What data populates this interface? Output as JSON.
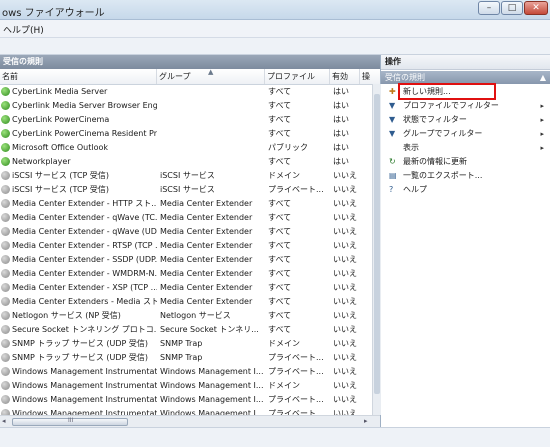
{
  "window": {
    "title": "ows ファイアウォール",
    "min": "–",
    "max": "□",
    "close": "✕"
  },
  "menu": {
    "help": "ヘルプ(H)"
  },
  "left_pane": {
    "header": "受信の規則",
    "columns": {
      "name": "名前",
      "group": "グループ",
      "profile": "プロファイル",
      "enabled": "有効",
      "action": "操"
    },
    "rows": [
      {
        "name": "CyberLink Media Server",
        "group": "",
        "profile": "すべて",
        "enabled": "はい",
        "icon": "on"
      },
      {
        "name": "Cyberlink Media Server Browser Eng...",
        "group": "",
        "profile": "すべて",
        "enabled": "はい",
        "icon": "on"
      },
      {
        "name": "CyberLink PowerCinema",
        "group": "",
        "profile": "すべて",
        "enabled": "はい",
        "icon": "on"
      },
      {
        "name": "CyberLink PowerCinema Resident Pr...",
        "group": "",
        "profile": "すべて",
        "enabled": "はい",
        "icon": "on"
      },
      {
        "name": "Microsoft Office Outlook",
        "group": "",
        "profile": "パブリック",
        "enabled": "はい",
        "icon": "on"
      },
      {
        "name": "Networkplayer",
        "group": "",
        "profile": "すべて",
        "enabled": "はい",
        "icon": "on"
      },
      {
        "name": "iSCSI サービス (TCP 受信)",
        "group": "iSCSI サービス",
        "profile": "ドメイン",
        "enabled": "いいえ",
        "icon": "off"
      },
      {
        "name": "iSCSI サービス (TCP 受信)",
        "group": "iSCSI サービス",
        "profile": "プライベート...",
        "enabled": "いいえ",
        "icon": "off"
      },
      {
        "name": "Media Center Extender - HTTP スト...",
        "group": "Media Center Extender",
        "profile": "すべて",
        "enabled": "いいえ",
        "icon": "off"
      },
      {
        "name": "Media Center Extender - qWave (TC...",
        "group": "Media Center Extender",
        "profile": "すべて",
        "enabled": "いいえ",
        "icon": "off"
      },
      {
        "name": "Media Center Extender - qWave (UD...",
        "group": "Media Center Extender",
        "profile": "すべて",
        "enabled": "いいえ",
        "icon": "off"
      },
      {
        "name": "Media Center Extender - RTSP (TCP ...",
        "group": "Media Center Extender",
        "profile": "すべて",
        "enabled": "いいえ",
        "icon": "off"
      },
      {
        "name": "Media Center Extender - SSDP (UDP...",
        "group": "Media Center Extender",
        "profile": "すべて",
        "enabled": "いいえ",
        "icon": "off"
      },
      {
        "name": "Media Center Extender - WMDRM-N...",
        "group": "Media Center Extender",
        "profile": "すべて",
        "enabled": "いいえ",
        "icon": "off"
      },
      {
        "name": "Media Center Extender - XSP (TCP ...",
        "group": "Media Center Extender",
        "profile": "すべて",
        "enabled": "いいえ",
        "icon": "off"
      },
      {
        "name": "Media Center Extenders - Media スト...",
        "group": "Media Center Extender",
        "profile": "すべて",
        "enabled": "いいえ",
        "icon": "off"
      },
      {
        "name": "Netlogon サービス (NP 受信)",
        "group": "Netlogon サービス",
        "profile": "すべて",
        "enabled": "いいえ",
        "icon": "off"
      },
      {
        "name": "Secure Socket トンネリング プロトコ...",
        "group": "Secure Socket トンネリ...",
        "profile": "すべて",
        "enabled": "いいえ",
        "icon": "off"
      },
      {
        "name": "SNMP トラップ サービス (UDP 受信)",
        "group": "SNMP Trap",
        "profile": "ドメイン",
        "enabled": "いいえ",
        "icon": "off"
      },
      {
        "name": "SNMP トラップ サービス (UDP 受信)",
        "group": "SNMP Trap",
        "profile": "プライベート...",
        "enabled": "いいえ",
        "icon": "off"
      },
      {
        "name": "Windows Management Instrumentat...",
        "group": "Windows Management I...",
        "profile": "プライベート...",
        "enabled": "いいえ",
        "icon": "off"
      },
      {
        "name": "Windows Management Instrumentat...",
        "group": "Windows Management I...",
        "profile": "ドメイン",
        "enabled": "いいえ",
        "icon": "off"
      },
      {
        "name": "Windows Management Instrumentat...",
        "group": "Windows Management I...",
        "profile": "プライベート...",
        "enabled": "いいえ",
        "icon": "off"
      },
      {
        "name": "Windows Management Instrumentat...",
        "group": "Windows Management I...",
        "profile": "プライベート...",
        "enabled": "いいえ",
        "icon": "off"
      }
    ],
    "hscroll_grip": "III"
  },
  "actions_pane": {
    "header": "操作",
    "section": "受信の規則",
    "items": [
      {
        "label": "新しい規則...",
        "icon": "new-rule-icon",
        "glyph": "✚",
        "submenu": ""
      },
      {
        "label": "プロファイルでフィルター",
        "icon": "filter-icon",
        "glyph": "▼",
        "submenu": "▸"
      },
      {
        "label": "状態でフィルター",
        "icon": "filter-icon",
        "glyph": "▼",
        "submenu": "▸"
      },
      {
        "label": "グループでフィルター",
        "icon": "filter-icon",
        "glyph": "▼",
        "submenu": "▸"
      },
      {
        "label": "表示",
        "icon": "",
        "glyph": "",
        "submenu": "▸"
      },
      {
        "label": "最新の情報に更新",
        "icon": "refresh-icon",
        "glyph": "↻",
        "submenu": ""
      },
      {
        "label": "一覧のエクスポート...",
        "icon": "export-icon",
        "glyph": "▤",
        "submenu": ""
      },
      {
        "label": "ヘルプ",
        "icon": "help-icon",
        "glyph": "?",
        "submenu": ""
      }
    ]
  },
  "colors": {
    "highlight": "#e01010",
    "enabled_icon": "#2f8a1e",
    "disabled_icon": "#8a8a8a"
  }
}
